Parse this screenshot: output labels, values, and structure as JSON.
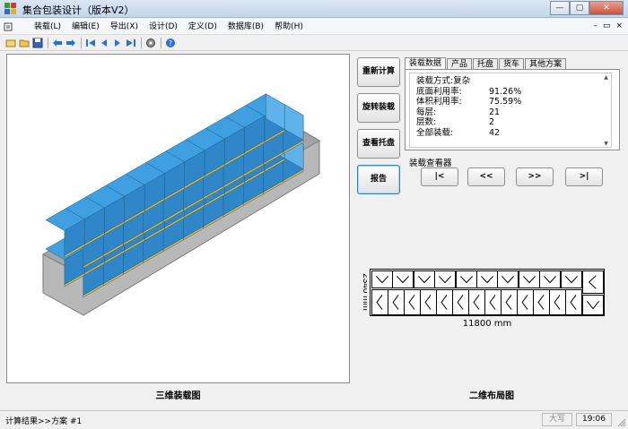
{
  "window": {
    "title": "集合包装设计（版本V2）",
    "min_label": "—",
    "max_label": "▢",
    "close_label": "✕"
  },
  "menu": {
    "items": [
      "装载(L)",
      "编辑(E)",
      "导出(X)",
      "设计(D)",
      "定义(D)",
      "数据库(B)",
      "帮助(H)"
    ],
    "mdi_min": "–",
    "mdi_restore": "▭",
    "mdi_close": "×"
  },
  "toolbar": {
    "icons": [
      "new-icon",
      "open-icon",
      "save-icon",
      "back-icon",
      "forward-icon",
      "first-icon",
      "prev-icon",
      "next-icon",
      "last-icon",
      "settings-icon",
      "help-icon"
    ]
  },
  "view3d": {
    "label": "三维装载图"
  },
  "actions": {
    "recalc": "重新计算",
    "rotate": "旋转装载",
    "view_pallet": "查看托盘",
    "report": "报告"
  },
  "tabs": [
    "装载数据",
    "产品",
    "托盘",
    "货车",
    "其他方案"
  ],
  "load_data": {
    "rows": [
      {
        "label": "装载方式:复杂",
        "value": ""
      },
      {
        "label": "底面利用率:",
        "value": "91.26%"
      },
      {
        "label": "体积利用率:",
        "value": "75.59%"
      },
      {
        "label": "每层:",
        "value": "21"
      },
      {
        "label": "层数:",
        "value": "2"
      },
      {
        "label": "全部装载:",
        "value": "42"
      }
    ],
    "scroll_up": "▲",
    "scroll_down": "▼"
  },
  "viewer": {
    "label": "装载查看器",
    "buttons": [
      "|<",
      "<<",
      ">>",
      ">|"
    ]
  },
  "layout2d": {
    "label": "二维布局图",
    "width_label": "11800 mm",
    "height_label": "2340 mm"
  },
  "status": {
    "text": "计算结果>>方案 #1",
    "caps": "大写",
    "time": "19:06"
  },
  "colors": {
    "box_blue": "#3f9fe0",
    "pallet_yellow": "#d8b640",
    "container_gray": "#8c8c8c"
  }
}
